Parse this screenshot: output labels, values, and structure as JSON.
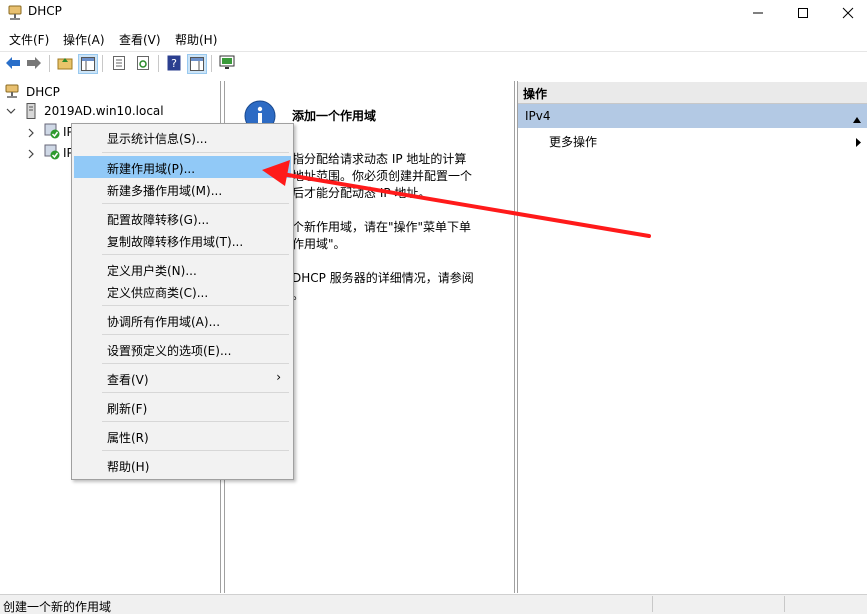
{
  "window": {
    "title": "DHCP"
  },
  "menubar": {
    "items": [
      "文件(F)",
      "操作(A)",
      "查看(V)",
      "帮助(H)"
    ]
  },
  "toolbar": {
    "icons": [
      "back-icon",
      "forward-icon",
      "up-folder-icon",
      "show-tree-icon",
      "properties-icon",
      "refresh-icon",
      "help-icon",
      "show-action-pane-icon",
      "monitor-icon"
    ]
  },
  "tree": {
    "root": "DHCP",
    "server": "2019AD.win10.local",
    "ipv4_partial": "IP",
    "ipv6_partial": "IP"
  },
  "content": {
    "title": "添加一个作用域",
    "lines": [
      "指分配给请求动态 IP 地址的计算",
      "地址范围。你必须创建并配置一个",
      "后才能分配动态 IP 地址。",
      "个新作用域，请在\"操作\"菜单下单",
      "作用域\"。",
      " DHCP 服务器的详细情况，请参阅",
      "。"
    ]
  },
  "actions": {
    "header": "操作",
    "section": "IPv4",
    "more": "更多操作"
  },
  "context_menu": {
    "items": [
      "显示统计信息(S)...",
      "新建作用域(P)...",
      "新建多播作用域(M)...",
      "配置故障转移(G)...",
      "复制故障转移作用域(T)...",
      "定义用户类(N)...",
      "定义供应商类(C)...",
      "协调所有作用域(A)...",
      "设置预定义的选项(E)...",
      "查看(V)",
      "刷新(F)",
      "属性(R)",
      "帮助(H)"
    ],
    "highlighted": "新建作用域(P)..."
  },
  "statusbar": {
    "text": "创建一个新的作用域"
  },
  "colors": {
    "highlight": "#91c9f7",
    "actions_section": "#b3c9e4",
    "annotation_arrow": "#ff1a1a"
  }
}
